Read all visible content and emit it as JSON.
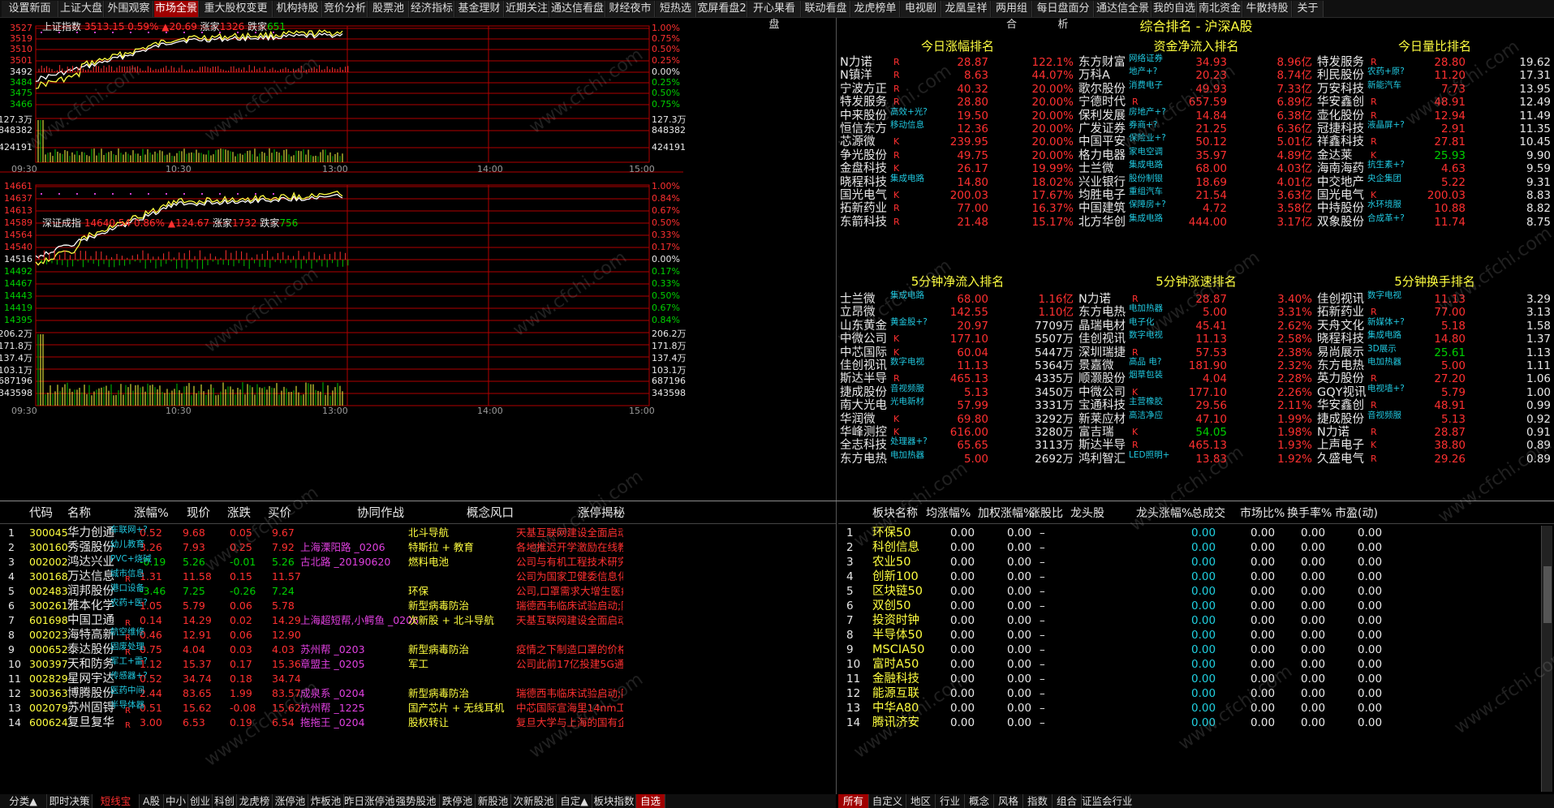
{
  "topnav": [
    "设置新面",
    "上证大盘",
    "外围观察",
    "市场全景",
    "重大股权变更",
    "机构持股",
    "竞价分析",
    "股票池",
    "经济指标",
    "基金理财",
    "近期关注",
    "通达信看盘",
    "财经夜市",
    "短热选",
    "宽屏看盘2",
    "开心果看盘",
    "联动看盘",
    "龙虎榜单",
    "电视剧",
    "龙凰呈祥",
    "两用组合",
    "每日盘面分析",
    "通达信全景",
    "我的自选",
    "南北资金",
    "牛散持股",
    "关于"
  ],
  "topnav_active": 3,
  "sh_chart": {
    "name": "上证指数",
    "price": "3513.15",
    "pct": "0.59%",
    "chg": "▲20.69",
    "up_label": "涨家",
    "up": "1326",
    "down_label": "跌家",
    "down": "651",
    "yl": [
      "3527",
      "3519",
      "3510",
      "3501",
      "3492",
      "3484",
      "3475",
      "3466"
    ],
    "yr": [
      "1.00%",
      "0.75%",
      "0.50%",
      "0.25%",
      "0.00%",
      "0.25%",
      "0.50%",
      "0.75%"
    ],
    "vl": [
      "127.3万",
      "848382",
      "424191"
    ],
    "vr": [
      "127.3万",
      "848382",
      "424191"
    ],
    "times": [
      "09:30",
      "10:30",
      "13:00",
      "14:00",
      "15:00"
    ]
  },
  "sz_chart": {
    "name": "深证成指",
    "price": "14640.54",
    "pct": "0.86%",
    "chg": "▲124.67",
    "up_label": "涨家",
    "up": "1732",
    "down_label": "跌家",
    "down": "756",
    "yl": [
      "14661",
      "14637",
      "14613",
      "14589",
      "14564",
      "14540",
      "14516",
      "14492",
      "14467",
      "14443",
      "14419",
      "14395"
    ],
    "yr": [
      "1.00%",
      "0.84%",
      "0.67%",
      "0.50%",
      "0.33%",
      "0.17%",
      "0.00%",
      "0.17%",
      "0.33%",
      "0.50%",
      "0.67%",
      "0.84%"
    ],
    "vl": [
      "206.2万",
      "171.8万",
      "137.4万",
      "103.1万",
      "687196",
      "343598"
    ],
    "vr": [
      "206.2万",
      "171.8万",
      "137.4万",
      "103.1万",
      "687196",
      "343598"
    ],
    "times": [
      "09:30",
      "10:30",
      "13:00",
      "14:00",
      "15:00"
    ]
  },
  "rank_title": "综合排名 - 沪深A股",
  "sections": {
    "a": "今日涨幅排名",
    "b": "资金净流入排名",
    "c": "今日量比排名",
    "d": "5分钟净流入排名",
    "e": "5分钟涨速排名",
    "f": "5分钟换手排名"
  },
  "rank_a": [
    [
      "N力诺",
      "",
      "R",
      "28.87",
      "122.1%"
    ],
    [
      "N镇洋",
      "",
      "R",
      "8.63",
      "44.07%"
    ],
    [
      "宁波方正",
      "",
      "R",
      "40.32",
      "20.00%"
    ],
    [
      "特发服务",
      "",
      "R",
      "28.80",
      "20.00%"
    ],
    [
      "中来股份",
      "高效+光?",
      "",
      "19.50",
      "20.00%"
    ],
    [
      "恒信东方",
      "移动信息",
      "",
      "12.36",
      "20.00%"
    ],
    [
      "芯源微",
      "",
      "K",
      "239.95",
      "20.00%"
    ],
    [
      "争光股份",
      "",
      "R",
      "49.75",
      "20.00%"
    ],
    [
      "金盘科技",
      "",
      "K",
      "26.17",
      "19.99%"
    ],
    [
      "晓程科技",
      "集成电路",
      "",
      "14.80",
      "18.02%"
    ],
    [
      "国光电气",
      "",
      "K",
      "200.03",
      "17.67%"
    ],
    [
      "拓新药业",
      "",
      "R",
      "77.00",
      "16.37%"
    ],
    [
      "东箭科技",
      "",
      "R",
      "21.48",
      "15.17%"
    ]
  ],
  "rank_b": [
    [
      "东方财富",
      "网络证券",
      "",
      "34.93",
      "8.96亿"
    ],
    [
      "万科A",
      "地产+?",
      "",
      "20.23",
      "8.74亿"
    ],
    [
      "歌尔股份",
      "消费电子",
      "",
      "49.93",
      "7.33亿"
    ],
    [
      "宁德时代",
      "",
      "R",
      "657.59",
      "6.89亿"
    ],
    [
      "保利发展",
      "房地产+?",
      "",
      "14.84",
      "6.38亿"
    ],
    [
      "广发证券",
      "券商+?",
      "",
      "21.25",
      "6.36亿"
    ],
    [
      "中国平安",
      "保险业+?",
      "",
      "50.12",
      "5.01亿"
    ],
    [
      "格力电器",
      "家电空调",
      "",
      "35.97",
      "4.89亿"
    ],
    [
      "士兰微",
      "集成电路",
      "",
      "68.00",
      "4.03亿"
    ],
    [
      "兴业银行",
      "股份制银",
      "",
      "18.69",
      "4.01亿"
    ],
    [
      "均胜电子",
      "重组汽车",
      "",
      "21.54",
      "3.63亿"
    ],
    [
      "中国建筑",
      "保障房+?",
      "",
      "4.72",
      "3.58亿"
    ],
    [
      "北方华创",
      "集成电路",
      "",
      "444.00",
      "3.17亿"
    ]
  ],
  "rank_c": [
    [
      "特发服务",
      "",
      "R",
      "28.80",
      "19.62"
    ],
    [
      "利民股份",
      "农药+原?",
      "",
      "11.20",
      "17.31"
    ],
    [
      "万安科技",
      "新能汽车",
      "",
      "7.73",
      "13.95"
    ],
    [
      "华安鑫创",
      "",
      "R",
      "48.91",
      "12.49"
    ],
    [
      "壶化股份",
      "",
      "R",
      "12.94",
      "11.49"
    ],
    [
      "冠捷科技",
      "液晶屏+?",
      "",
      "2.91",
      "11.35"
    ],
    [
      "祥鑫科技",
      "",
      "R",
      "27.81",
      "10.45"
    ],
    [
      "金达莱",
      "",
      "K",
      "25.93",
      "9.90"
    ],
    [
      "海南海药",
      "抗生素+?",
      "",
      "4.63",
      "9.59"
    ],
    [
      "中交地产",
      "央企集团",
      "",
      "5.22",
      "9.31"
    ],
    [
      "国光电气",
      "",
      "K",
      "200.03",
      "8.83"
    ],
    [
      "中持股份",
      "水环境服",
      "",
      "10.88",
      "8.82"
    ],
    [
      "双象股份",
      "合成革+?",
      "",
      "11.74",
      "8.75"
    ]
  ],
  "rank_d": [
    [
      "士兰微",
      "集成电路",
      "",
      "68.00",
      "1.16亿"
    ],
    [
      "立昂微",
      "",
      "",
      "142.55",
      "1.10亿"
    ],
    [
      "山东黄金",
      "黄金股+?",
      "",
      "20.97",
      "7709万"
    ],
    [
      "中微公司",
      "",
      "K",
      "177.10",
      "5507万"
    ],
    [
      "中芯国际",
      "",
      "K",
      "60.04",
      "5447万"
    ],
    [
      "佳创视讯",
      "数字电视",
      "",
      "11.13",
      "5364万"
    ],
    [
      "斯达半导",
      "",
      "R",
      "465.13",
      "4335万"
    ],
    [
      "捷成股份",
      "音视频服",
      "",
      "5.13",
      "3450万"
    ],
    [
      "南大光电",
      "光电新材",
      "",
      "57.99",
      "3331万"
    ],
    [
      "华润微",
      "",
      "K",
      "69.80",
      "3292万"
    ],
    [
      "华峰测控",
      "",
      "K",
      "616.00",
      "3280万"
    ],
    [
      "全志科技",
      "处理器+?",
      "",
      "65.65",
      "3113万"
    ],
    [
      "东方电热",
      "电加热器",
      "",
      "5.00",
      "2692万"
    ]
  ],
  "rank_e": [
    [
      "N力诺",
      "",
      "R",
      "28.87",
      "3.40%"
    ],
    [
      "东方电热",
      "电加热器",
      "",
      "5.00",
      "3.31%"
    ],
    [
      "晶瑞电材",
      "电子化",
      "",
      "45.41",
      "2.62%"
    ],
    [
      "佳创视讯",
      "数字电视",
      "",
      "11.13",
      "2.58%"
    ],
    [
      "深圳瑞捷",
      "",
      "R",
      "57.53",
      "2.38%"
    ],
    [
      "景嘉微",
      "高品 电?",
      "",
      "181.90",
      "2.32%"
    ],
    [
      "顺灏股份",
      "烟草包装",
      "",
      "4.04",
      "2.28%"
    ],
    [
      "中微公司",
      "",
      "K",
      "177.10",
      "2.26%"
    ],
    [
      "宝通科技",
      "主营橡胶",
      "",
      "29.56",
      "2.11%"
    ],
    [
      "新莱应材",
      "高洁净应",
      "",
      "47.10",
      "1.99%"
    ],
    [
      "富吉瑞",
      "",
      "K",
      "54.05",
      "1.98%"
    ],
    [
      "斯达半导",
      "",
      "R",
      "465.13",
      "1.93%"
    ],
    [
      "鸿利智汇",
      "LED照明+",
      "",
      "13.83",
      "1.92%"
    ]
  ],
  "rank_f": [
    [
      "佳创视讯",
      "数字电视",
      "",
      "11.13",
      "3.29"
    ],
    [
      "拓新药业",
      "",
      "R",
      "77.00",
      "3.13"
    ],
    [
      "天舟文化",
      "新媒体+?",
      "",
      "5.18",
      "1.58"
    ],
    [
      "晓程科技",
      "集成电路",
      "",
      "14.80",
      "1.37"
    ],
    [
      "易尚展示",
      "3D展示",
      "",
      "25.61",
      "1.13"
    ],
    [
      "东方电热",
      "电加热器",
      "",
      "5.00",
      "1.11"
    ],
    [
      "英力股份",
      "",
      "R",
      "27.20",
      "1.06"
    ],
    [
      "GQY视讯",
      "电视墙+?",
      "",
      "5.79",
      "1.00"
    ],
    [
      "华安鑫创",
      "",
      "R",
      "48.91",
      "0.99"
    ],
    [
      "捷成股份",
      "音视频服",
      "",
      "5.13",
      "0.92"
    ],
    [
      "N力诺",
      "",
      "R",
      "28.87",
      "0.91"
    ],
    [
      "上声电子",
      "",
      "K",
      "38.80",
      "0.89"
    ],
    [
      "久盛电气",
      "",
      "R",
      "29.26",
      "0.89"
    ]
  ],
  "stock_headers": [
    "代码",
    "名称",
    "涨幅%",
    "现价",
    "涨跌",
    "买价",
    "协同作战",
    "概念风口",
    "涨停揭秘"
  ],
  "stocks": [
    [
      "1",
      "300045",
      "华力创通",
      "车联网+?",
      "",
      "0.52",
      "9.68",
      "0.05",
      "9.67",
      "",
      "北斗导航",
      "天基互联网建设全面启动;公"
    ],
    [
      "2",
      "300160",
      "秀强股份",
      "幼儿教育",
      "",
      "3.26",
      "7.93",
      "0.25",
      "7.92",
      "上海溧阳路 _0206",
      "特斯拉 + 教育",
      "各地推迟开学激励在线教育"
    ],
    [
      "3",
      "002002",
      "鸿达兴业",
      "PVC+烧碱",
      "",
      "-0.19",
      "5.26",
      "-0.01",
      "5.26",
      "古北路 _20190620",
      "燃料电池",
      "公司与有机工程技术研究院"
    ],
    [
      "4",
      "300168",
      "万达信息",
      "城市信息",
      "R",
      "1.31",
      "11.58",
      "0.15",
      "11.57",
      "",
      "",
      "公司为国家卫健委信息化建设"
    ],
    [
      "5",
      "002483",
      "润邦股份",
      "港口设备",
      "",
      "-3.46",
      "7.25",
      "-0.26",
      "7.24",
      "",
      "环保",
      "公司,口罩需求大增生医疗"
    ],
    [
      "6",
      "300261",
      "雅本化学",
      "农药+医?",
      "",
      "1.05",
      "5.79",
      "0.06",
      "5.78",
      "",
      "新型病毒防治",
      "瑞德西韦临床试验启动;阿比"
    ],
    [
      "7",
      "601698",
      "中国卫通",
      "",
      "R",
      "0.14",
      "14.29",
      "0.02",
      "14.29",
      "上海超短帮,小鳄鱼 _0206",
      "次新股 + 北斗导航",
      "天基互联网建设全面启动;公"
    ],
    [
      "8",
      "002023",
      "海特高新",
      "航空维修",
      "R",
      "0.46",
      "12.91",
      "0.06",
      "12.90",
      "",
      "",
      ""
    ],
    [
      "9",
      "000652",
      "泰达股份",
      "固废处理",
      "R",
      "0.75",
      "4.04",
      "0.03",
      "4.03",
      "苏州帮 _0203",
      "新型病毒防治",
      "疫情之下制造口罩的价格涨"
    ],
    [
      "10",
      "300397",
      "天和防务",
      "军工+雷?",
      "",
      "1.12",
      "15.37",
      "0.17",
      "15.36",
      "章盟主 _0205",
      "军工",
      "公司此前17亿投建5G通讯产"
    ],
    [
      "11",
      "002829",
      "星网宇达",
      "传感器+?",
      "",
      "0.52",
      "34.74",
      "0.18",
      "34.74",
      "",
      "",
      ""
    ],
    [
      "12",
      "300363",
      "博腾股份",
      "医药中间",
      "",
      "2.44",
      "83.65",
      "1.99",
      "83.57",
      "成泉系 _0204",
      "新型病毒防治",
      "瑞德西韦临床试验启动;阿比"
    ],
    [
      "13",
      "002079",
      "苏州固锝",
      "半导体器",
      "R",
      "0.51",
      "15.62",
      "-0.08",
      "15.62",
      "杭州帮 _1225",
      "国产芯片 + 无线耳机",
      "中芯国际宣海里14nm工艺大"
    ],
    [
      "14",
      "600624",
      "复旦复华",
      "",
      "R",
      "3.00",
      "6.53",
      "0.19",
      "6.54",
      "拖拖王 _0204",
      "股权转让",
      "复旦大学与上海的国有企业转"
    ]
  ],
  "board_headers": [
    "板块名称",
    "均涨幅%",
    "加权涨幅%",
    "涨股比",
    "龙头股",
    "龙头涨幅%",
    "总成交",
    "市场比%",
    "换手率%",
    "市盈(动)"
  ],
  "boards": [
    [
      "1",
      "环保50"
    ],
    [
      "2",
      "科创信息"
    ],
    [
      "3",
      "农业50"
    ],
    [
      "4",
      "创新100"
    ],
    [
      "5",
      "区块链50"
    ],
    [
      "6",
      "双创50"
    ],
    [
      "7",
      "投资时钟"
    ],
    [
      "8",
      "半导体50"
    ],
    [
      "9",
      "MSCIA50"
    ],
    [
      "10",
      "富时A50"
    ],
    [
      "11",
      "金融科技"
    ],
    [
      "12",
      "能源互联"
    ],
    [
      "13",
      "中华A80"
    ],
    [
      "14",
      "腾讯济安"
    ]
  ],
  "board_vals": {
    "a": "0.00",
    "b": "0.00",
    "c": "–",
    "d": "0.0",
    "e": "0.00",
    "f": "0.00"
  },
  "bottom_left": [
    "分类▲",
    "即时决策",
    "短线宝",
    "A股",
    "中小",
    "创业",
    "科创",
    "龙虎榜",
    "涨停池",
    "炸板池",
    "昨日涨停池",
    "强势股池",
    "跌停池",
    "新股池",
    "次新股池",
    "自定▲",
    "板块指数",
    "自选"
  ],
  "bottom_right": [
    "所有",
    "自定义",
    "地区",
    "行业",
    "概念",
    "风格",
    "指数",
    "组合",
    "证监会行业"
  ],
  "watermark": "www.cfchi.com",
  "colors": {
    "up": "#ff3030",
    "down": "#00d000",
    "grid": "#b00000",
    "yellow": "#ffff40",
    "cyan": "#20d0e0"
  }
}
